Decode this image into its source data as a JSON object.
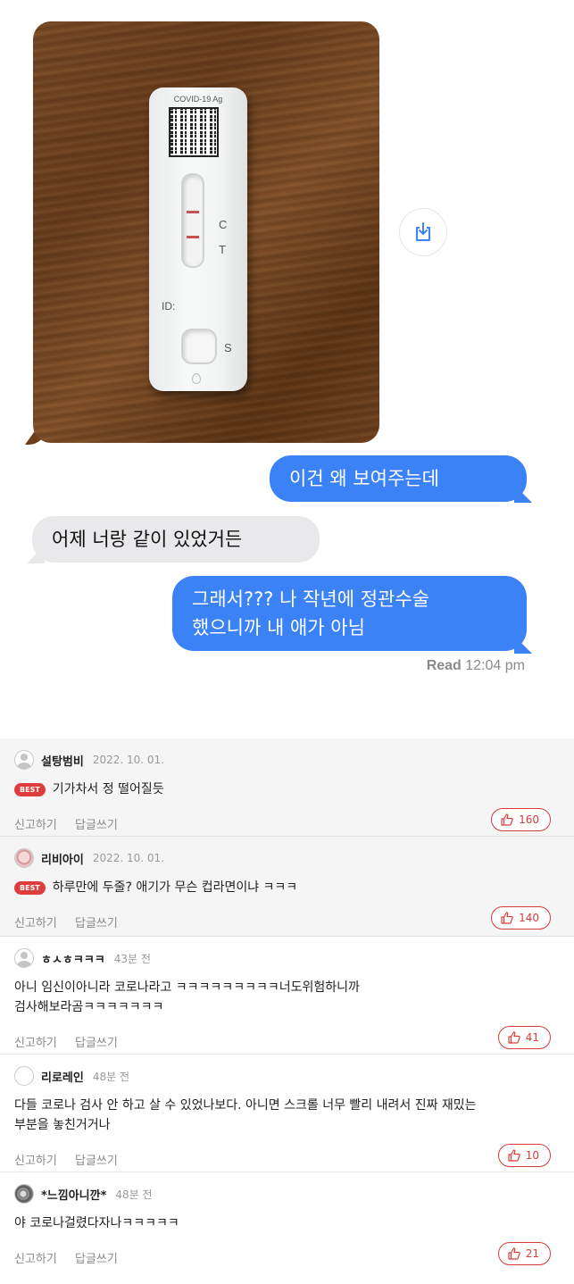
{
  "chat": {
    "photo": {
      "cassette_label": "COVID-19 Ag",
      "mark_c": "C",
      "mark_t": "T",
      "mark_id": "ID:",
      "mark_s": "S"
    },
    "save_icon": "save-to-device-icon",
    "messages": [
      {
        "from": "me",
        "text": "이건 왜 보여주는데"
      },
      {
        "from": "them",
        "text": "어제 너랑 같이 있었거든"
      },
      {
        "from": "me",
        "line1": "그래서??? 나 작년에 정관수술",
        "line2": "했으니까 내 애가 아님"
      }
    ],
    "read_label": "Read",
    "read_time": "12:04 pm"
  },
  "comments": [
    {
      "nick": "설탕범비",
      "date": "2022. 10. 01.",
      "badge": "BEST",
      "line1": "기가차서 정 떨어질듯",
      "line2": "",
      "report": "신고하기",
      "reply": "답글쓰기",
      "likes": "160",
      "avatar": "person"
    },
    {
      "nick": "리비아이",
      "date": "2022. 10. 01.",
      "badge": "BEST",
      "line1": "하루만에 두줄? 애기가 무슨 컵라면이냐 ㅋㅋㅋ",
      "line2": "",
      "report": "신고하기",
      "reply": "답글쓰기",
      "likes": "140",
      "avatar": "doll"
    },
    {
      "nick": "ㅎㅅㅎㅋㅋㅋ",
      "date": "43분 전",
      "badge": "",
      "line1": "아니 임신이아니라 코로나라고 ㅋㅋㅋㅋㅋㅋㅋㅋㅋ너도위험하니까",
      "line2": "검사해보라곰ㅋㅋㅋㅋㅋㅋㅋ",
      "report": "신고하기",
      "reply": "답글쓰기",
      "likes": "41",
      "avatar": "person"
    },
    {
      "nick": "리로레인",
      "date": "48분 전",
      "badge": "",
      "line1": "다들 코로나 검사 안 하고 살 수 있었나보다. 아니면 스크롤 너무 빨리 내려서 진짜 재밌는",
      "line2": "부분을 놓친거거나",
      "report": "신고하기",
      "reply": "답글쓰기",
      "likes": "10",
      "avatar": "none"
    },
    {
      "nick": "*느낌아니깐*",
      "date": "48분 전",
      "badge": "",
      "line1": "야 코로나걸렸다자나ㅋㅋㅋㅋㅋ",
      "line2": "",
      "report": "신고하기",
      "reply": "답글쓰기",
      "likes": "21",
      "avatar": "cat"
    }
  ]
}
